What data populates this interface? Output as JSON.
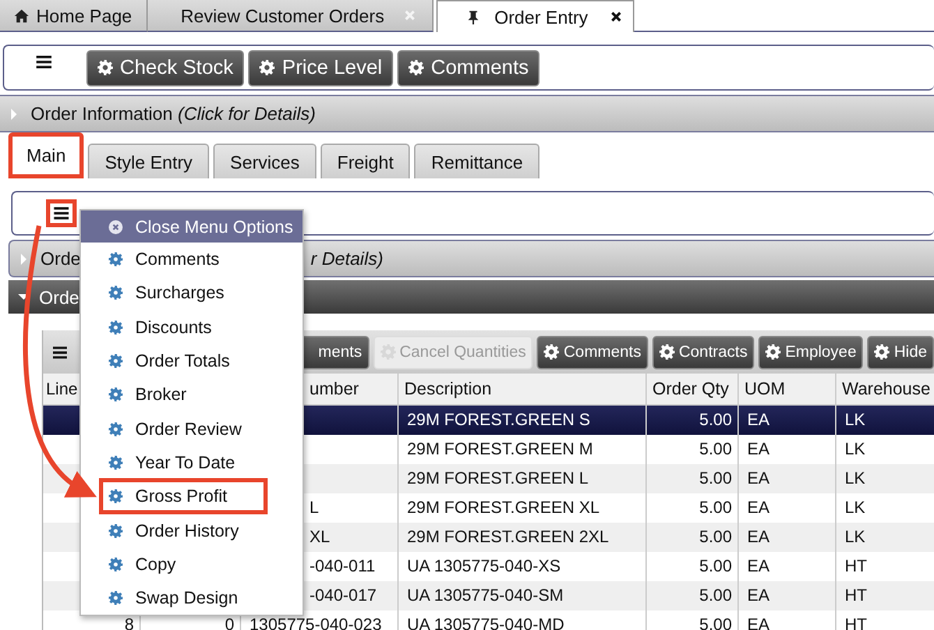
{
  "top_tabs": [
    {
      "label": "Home Page",
      "kind": "home",
      "selected": false
    },
    {
      "label": "Review Customer Orders",
      "kind": "closable",
      "selected": false
    },
    {
      "label": "Order Entry",
      "kind": "pinned",
      "selected": true
    }
  ],
  "toolbar": {
    "buttons": [
      "Check Stock",
      "Price Level",
      "Comments"
    ]
  },
  "order_information": {
    "title": "Order Information",
    "hint": "(Click for Details)"
  },
  "sub_tabs": [
    {
      "label": "Main",
      "selected": true,
      "callout": true
    },
    {
      "label": "Style Entry",
      "selected": false,
      "callout": false
    },
    {
      "label": "Services",
      "selected": false,
      "callout": false
    },
    {
      "label": "Freight",
      "selected": false,
      "callout": false
    },
    {
      "label": "Remittance",
      "selected": false,
      "callout": false
    }
  ],
  "main_panel": {
    "menu_callout": true
  },
  "collapsed_bar": {
    "left": "Orde",
    "right": "r Details)"
  },
  "dark_bar": {
    "title": "Orde"
  },
  "menu": {
    "items": [
      {
        "label": "Close Menu Options",
        "kind": "close",
        "callout": false
      },
      {
        "label": "Comments",
        "kind": "action",
        "callout": false
      },
      {
        "label": "Surcharges",
        "kind": "action",
        "callout": false
      },
      {
        "label": "Discounts",
        "kind": "action",
        "callout": false
      },
      {
        "label": "Order Totals",
        "kind": "action",
        "callout": false
      },
      {
        "label": "Broker",
        "kind": "action",
        "callout": false
      },
      {
        "label": "Order Review",
        "kind": "action",
        "callout": false
      },
      {
        "label": "Year To Date",
        "kind": "action",
        "callout": false
      },
      {
        "label": "Gross Profit",
        "kind": "action",
        "callout": true
      },
      {
        "label": "Order History",
        "kind": "action",
        "callout": false
      },
      {
        "label": "Copy",
        "kind": "action",
        "callout": false
      },
      {
        "label": "Swap Design",
        "kind": "action",
        "callout": false
      }
    ]
  },
  "lines_table": {
    "buttons": [
      {
        "label": "ments",
        "disabled": false
      },
      {
        "label": "Cancel Quantities",
        "disabled": true
      },
      {
        "label": "Comments",
        "disabled": false
      },
      {
        "label": "Contracts",
        "disabled": false
      },
      {
        "label": "Employee",
        "disabled": false
      },
      {
        "label": "Hide",
        "disabled": false
      }
    ],
    "columns": [
      "Line",
      null,
      "umber",
      "Description",
      "Order Qty",
      "UOM",
      "Warehouse"
    ],
    "rows": [
      {
        "selected": true,
        "cells": [
          null,
          null,
          null,
          "29M FOREST.GREEN S",
          "5.00",
          "EA",
          "LK"
        ]
      },
      {
        "selected": false,
        "cells": [
          null,
          null,
          null,
          "29M FOREST.GREEN M",
          "5.00",
          "EA",
          "LK"
        ]
      },
      {
        "selected": false,
        "cells": [
          null,
          null,
          null,
          "29M FOREST.GREEN L",
          "5.00",
          "EA",
          "LK"
        ]
      },
      {
        "selected": false,
        "cells": [
          null,
          null,
          "L",
          "29M FOREST.GREEN XL",
          "5.00",
          "EA",
          "LK"
        ]
      },
      {
        "selected": false,
        "cells": [
          null,
          null,
          "XL",
          "29M FOREST.GREEN 2XL",
          "5.00",
          "EA",
          "LK"
        ]
      },
      {
        "selected": false,
        "cells": [
          null,
          null,
          "-040-011",
          "UA 1305775-040-XS",
          "5.00",
          "EA",
          "HT"
        ]
      },
      {
        "selected": false,
        "cells": [
          null,
          null,
          "-040-017",
          "UA 1305775-040-SM",
          "5.00",
          "EA",
          "HT"
        ]
      },
      {
        "selected": false,
        "cells": [
          "8",
          "0",
          "1305775-040-023",
          "UA 1305775-040-MD",
          "5.00",
          "EA",
          "HT"
        ]
      }
    ]
  }
}
